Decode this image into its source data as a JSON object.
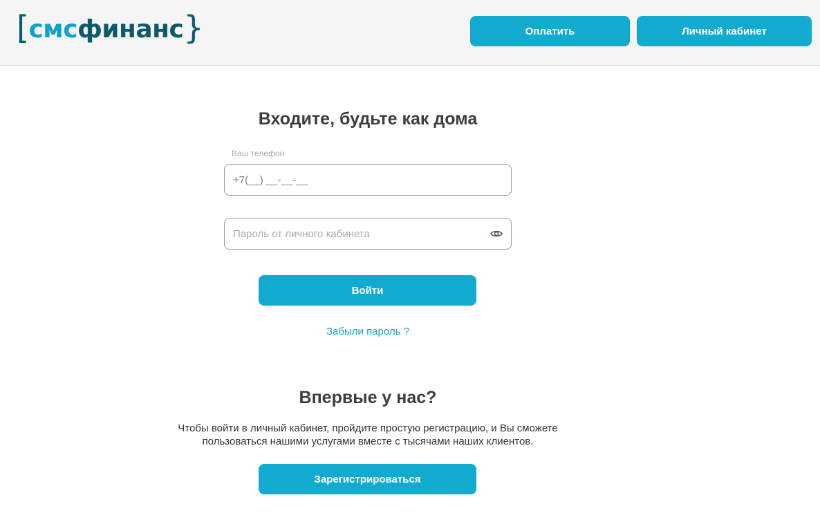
{
  "header": {
    "logo": {
      "bracket_open": "[",
      "part_sms": "смс",
      "part_finance": "финанс",
      "bracket_close": "}"
    },
    "pay_button": "Оплатить",
    "cabinet_button": "Личный кабинет"
  },
  "login": {
    "title": "Входите, будьте как дома",
    "phone_label": "Ваш телефон",
    "phone_value": "+7(__) __-__-__",
    "password_placeholder": "Пароль от личного кабинета",
    "password_toggle_icon": "eye-icon",
    "submit_button": "Войти",
    "forgot_link": "Забыли пароль ?"
  },
  "register": {
    "title": "Впервые у нас?",
    "description_line1": "Чтобы войти в личный кабинет, пройдите простую регистрацию, и Вы сможете",
    "description_line2": "пользоваться нашими услугами вместе с тысячами наших клиентов.",
    "button": "Зарегистрироваться"
  },
  "colors": {
    "accent": "#12abcf",
    "logo_dark": "#0d5a6e",
    "logo_light": "#0ea3c9",
    "link": "#1ba5c6",
    "header_bg": "#f5f5f5"
  }
}
